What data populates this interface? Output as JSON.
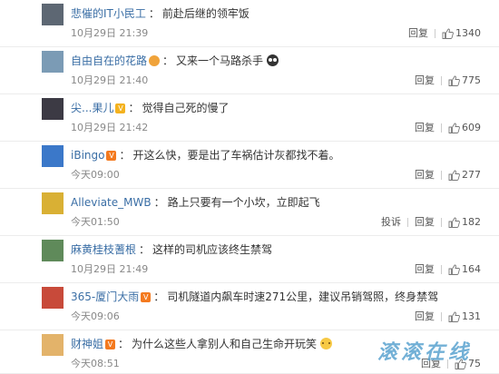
{
  "comments": [
    {
      "user": "悲催的IT小民工",
      "badge": "",
      "text": "前赴后继的领牢饭",
      "emoji": "",
      "time": "10月29日 21:39",
      "report": "",
      "reply": "回复",
      "likes": "1340"
    },
    {
      "user": "自由自在的花路",
      "badge": "crown",
      "text": "又来一个马路杀手",
      "emoji": "dark",
      "time": "10月29日 21:40",
      "report": "",
      "reply": "回复",
      "likes": "775"
    },
    {
      "user": "尖...果儿",
      "badge": "gold",
      "text": "觉得自己死的慢了",
      "emoji": "",
      "time": "10月29日 21:42",
      "report": "",
      "reply": "回复",
      "likes": "609"
    },
    {
      "user": "iBingo",
      "badge": "orange",
      "text": "开这么快，要是出了车祸估计灰都找不着。",
      "emoji": "",
      "time": "今天09:00",
      "report": "",
      "reply": "回复",
      "likes": "277"
    },
    {
      "user": "Alleviate_MWB",
      "badge": "",
      "text": "路上只要有一个小坎，立即起飞",
      "emoji": "",
      "time": "今天01:50",
      "report": "投诉",
      "reply": "回复",
      "likes": "182"
    },
    {
      "user": "麻黄桂枝蓍根",
      "badge": "",
      "text": "这样的司机应该终生禁驾",
      "emoji": "",
      "time": "10月29日 21:49",
      "report": "",
      "reply": "回复",
      "likes": "164"
    },
    {
      "user": "365-厦门大雨",
      "badge": "orange",
      "text": "司机隧道内飙车时速271公里，建议吊销驾照，终身禁驾",
      "emoji": "",
      "time": "今天09:06",
      "report": "",
      "reply": "回复",
      "likes": "131"
    },
    {
      "user": "财神姐",
      "badge": "orange",
      "text": "为什么这些人拿别人和自己生命开玩笑",
      "emoji": "yellow",
      "time": "今天08:51",
      "report": "",
      "reply": "回复",
      "likes": "75"
    }
  ],
  "avatar_colors": [
    "#5d6773",
    "#7b9bb5",
    "#3c3a44",
    "#3b78c9",
    "#d9b034",
    "#5f8a5a",
    "#c84a3a",
    "#e3b36a"
  ],
  "colors": {
    "username": "#3a6ea5",
    "watermark": "#5aa3d0"
  },
  "watermark": "滚滚在线"
}
